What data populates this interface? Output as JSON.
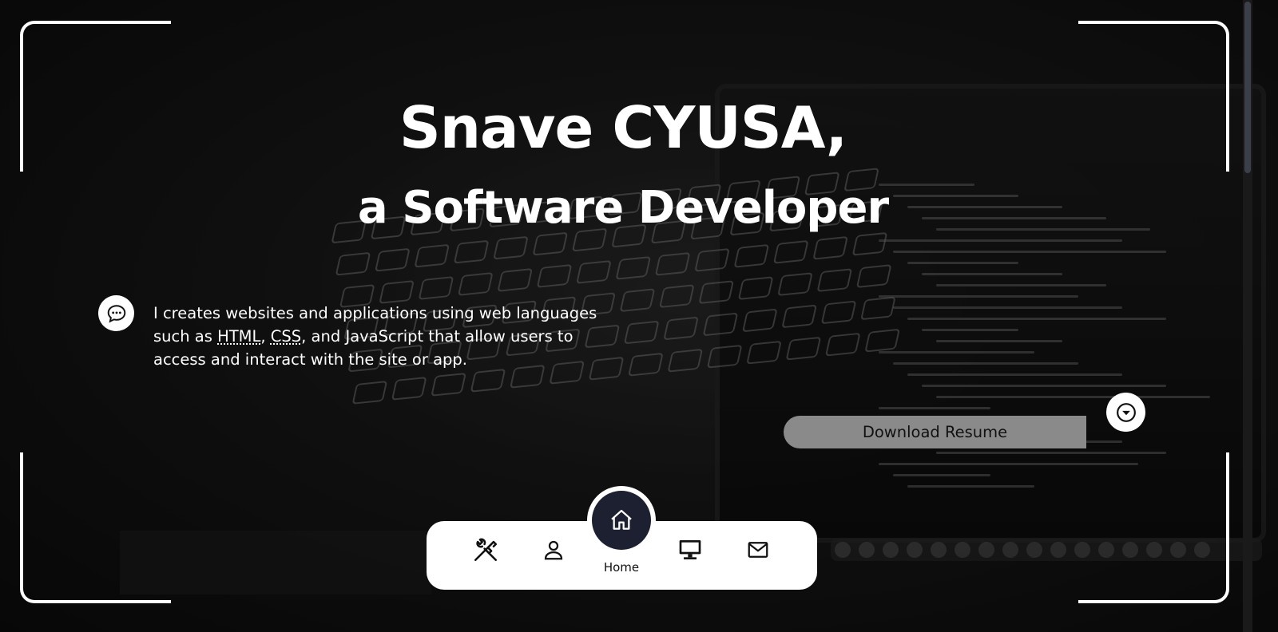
{
  "hero": {
    "name_line": "Snave CYUSA,",
    "role_line": "a Software Developer"
  },
  "intro": {
    "text_before": "I creates websites and applications using web languages such as ",
    "abbr_html": "HTML",
    "sep1": ", ",
    "abbr_css": "CSS",
    "text_after": ", and JavaScript that allow users to access and interact with the site or app."
  },
  "actions": {
    "download_label": "Download Resume"
  },
  "nav": {
    "items": [
      {
        "icon": "tools-icon"
      },
      {
        "icon": "user-icon"
      },
      {
        "icon": "home-icon",
        "label": "Home",
        "active": true
      },
      {
        "icon": "monitor-icon"
      },
      {
        "icon": "mail-icon"
      }
    ]
  },
  "colors": {
    "background": "#0f0f10",
    "accent_dark": "#1c2030",
    "button_grey": "#8a8a8a",
    "white": "#ffffff"
  }
}
